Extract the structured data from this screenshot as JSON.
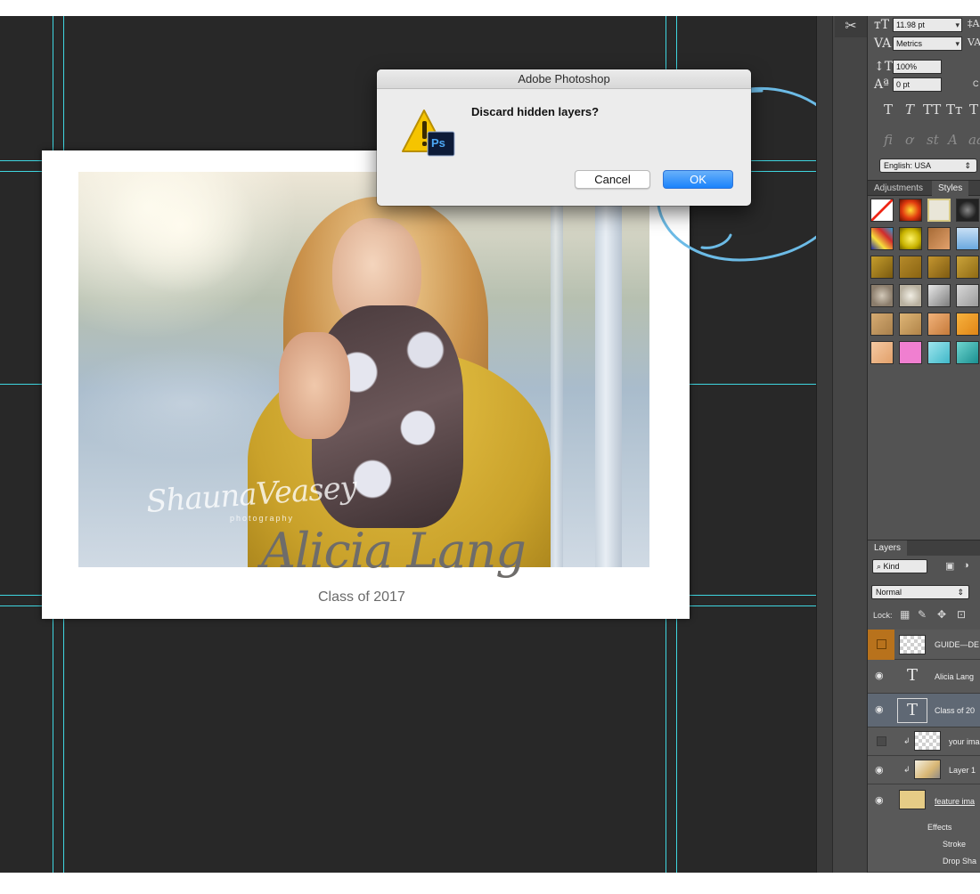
{
  "dialog": {
    "title": "Adobe Photoshop",
    "message": "Discard hidden layers?",
    "cancel_label": "Cancel",
    "ok_label": "OK",
    "app_badge": "Ps"
  },
  "document": {
    "watermark_script": "ShaunaVeasey",
    "watermark_sub": "photography",
    "name_text": "Alicia Lang",
    "class_text": "Class of 2017"
  },
  "character_panel": {
    "font_size": "11.98 pt",
    "kerning": "Metrics",
    "vertical_scale": "100%",
    "baseline_shift": "0 pt",
    "language": "English: USA",
    "type_buttons": [
      "T",
      "T",
      "TT",
      "Tт",
      "T"
    ],
    "opentype_buttons": [
      "fi",
      "ơ",
      "st",
      "A",
      "aa"
    ],
    "color_label_partial": "C"
  },
  "styles_panel": {
    "tabs": [
      "Adjustments",
      "Styles"
    ],
    "active_tab": "Styles"
  },
  "layers_panel": {
    "tab": "Layers",
    "filter_kind": "Kind",
    "blend_mode": "Normal",
    "lock_label": "Lock:",
    "layers": [
      {
        "name": "GUIDE—DE",
        "type": "raster",
        "visible": false
      },
      {
        "name": "Alicia Lang",
        "type": "text",
        "visible": true
      },
      {
        "name": "Class of 20",
        "type": "text",
        "visible": true,
        "selected": true
      },
      {
        "name": "your ima",
        "type": "raster",
        "visible": false
      },
      {
        "name": "Layer 1",
        "type": "raster",
        "visible": true
      },
      {
        "name": "feature ima",
        "type": "shape",
        "visible": true
      }
    ],
    "effects_label": "Effects",
    "effects": [
      "Stroke",
      "Drop Sha"
    ]
  },
  "colors": {
    "canvas_bg": "#282828",
    "guide": "#3fd6e0",
    "ok_button": "#1a82fb",
    "annotation_circle": "#6cbbe6",
    "panel_bg": "#535353",
    "selected_layer": "#5f6874"
  },
  "icons": {
    "dock_tool": "tool-settings-icon",
    "warning": "warning-triangle-icon",
    "eye": "eye-icon"
  }
}
